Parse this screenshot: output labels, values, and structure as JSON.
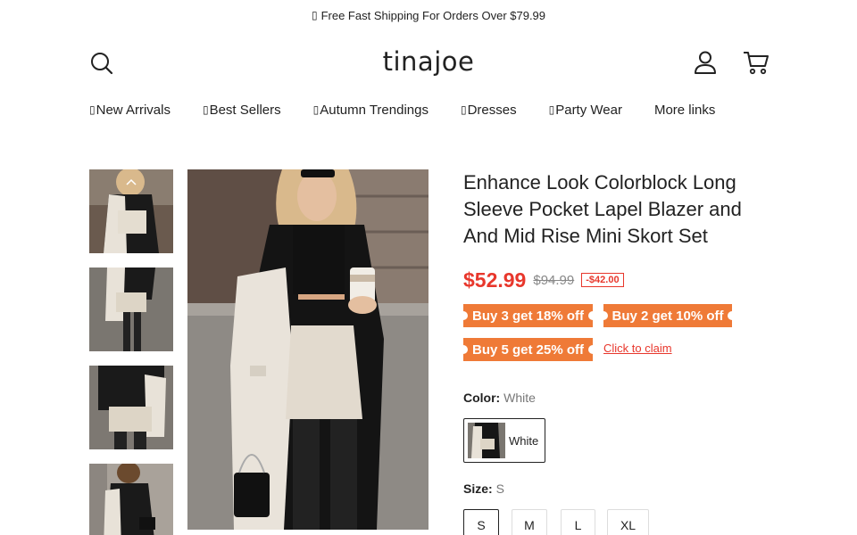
{
  "announcement": {
    "glyph": "▯",
    "text": "Free Fast Shipping For Orders Over $79.99"
  },
  "store": {
    "name": "tinajoe"
  },
  "nav": [
    {
      "glyph": "▯",
      "label": "New Arrivals"
    },
    {
      "glyph": "▯",
      "label": "Best Sellers"
    },
    {
      "glyph": "▯",
      "label": "Autumn Trendings"
    },
    {
      "glyph": "▯",
      "label": "Dresses"
    },
    {
      "glyph": "▯",
      "label": "Party Wear"
    },
    {
      "glyph": "",
      "label": "More links"
    }
  ],
  "icons": {
    "search": "search-icon",
    "account": "user-icon",
    "cart": "cart-icon",
    "thumb_up": "chevron-up-icon"
  },
  "product": {
    "title": "Enhance Look Colorblock Long Sleeve Pocket Lapel Blazer and And Mid Rise Mini Skort Set",
    "price": "$52.99",
    "compare_price": "$94.99",
    "discount": "-$42.00",
    "promos": [
      "Buy 3 get 18% off",
      "Buy 2 get 10% off",
      "Buy 5 get 25% off"
    ],
    "claim_link": "Click to claim",
    "color_label": "Color:",
    "color_value": "White",
    "color_options": [
      "White"
    ],
    "size_label": "Size:",
    "size_value": "S",
    "sizes": [
      "S",
      "M",
      "L",
      "XL"
    ]
  },
  "colors": {
    "accent": "#e8372c",
    "promo": "#ef7a37"
  }
}
